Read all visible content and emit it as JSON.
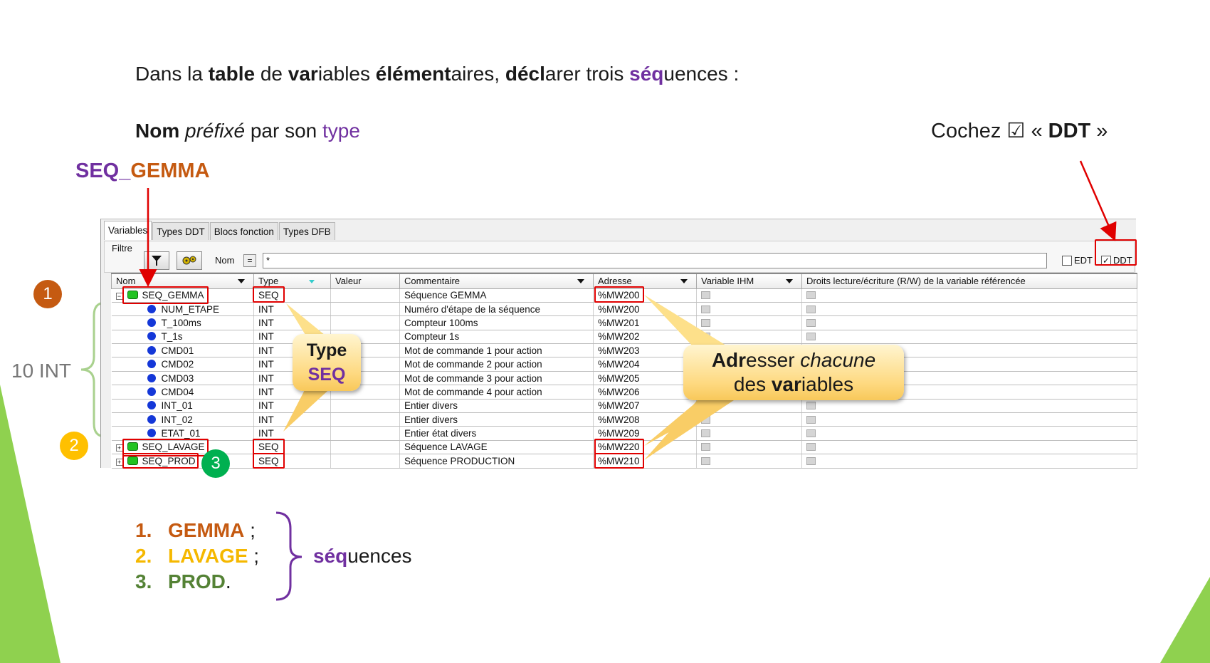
{
  "title": {
    "parts": [
      {
        "text": "Dans la ",
        "bold": false,
        "purple": false
      },
      {
        "text": "table",
        "bold": true,
        "purple": false
      },
      {
        "text": " de ",
        "bold": false,
        "purple": false
      },
      {
        "text": "var",
        "bold": true,
        "purple": false
      },
      {
        "text": "iables ",
        "bold": false,
        "purple": false
      },
      {
        "text": "élément",
        "bold": true,
        "purple": false
      },
      {
        "text": "aires, ",
        "bold": false,
        "purple": false
      },
      {
        "text": "décl",
        "bold": true,
        "purple": false
      },
      {
        "text": "arer trois ",
        "bold": false,
        "purple": false
      },
      {
        "text": "séq",
        "bold": true,
        "purple": true
      },
      {
        "text": "uences :",
        "bold": false,
        "purple": false
      }
    ]
  },
  "subtitle": {
    "nom": "Nom",
    "prefixe": "préfixé",
    "par_son": " par son ",
    "type": "type"
  },
  "cochez": {
    "before": "Cochez ☑ « ",
    "ddt": "DDT",
    "after": " »"
  },
  "seq_gemma_label": {
    "prefix": "SEQ_",
    "suffix": "GEMMA"
  },
  "ten_int_label": "10 INT",
  "badges": [
    "1",
    "2",
    "3"
  ],
  "window": {
    "tabs": [
      "Variables",
      "Types DDT",
      "Blocs fonction",
      "Types DFB"
    ],
    "filter_label": "Filtre",
    "nom_label": "Nom",
    "eq_label": "=",
    "filter_value": "*",
    "edt_label": "EDT",
    "ddt_label": "DDT",
    "columns": [
      "Nom",
      "Type",
      "Valeur",
      "Commentaire",
      "Adresse",
      "Variable IHM",
      "Droits lecture/écriture (R/W) de la variable référencée"
    ],
    "rows": [
      {
        "name": "SEQ_GEMMA",
        "type": "SEQ",
        "comment": "Séquence GEMMA",
        "address": "%MW200",
        "kind": "struct",
        "expand": "−"
      },
      {
        "name": "NUM_ETAPE",
        "type": "INT",
        "comment": "Numéro d'étape de la séquence",
        "address": "%MW200",
        "kind": "int"
      },
      {
        "name": "T_100ms",
        "type": "INT",
        "comment": "Compteur 100ms",
        "address": "%MW201",
        "kind": "int"
      },
      {
        "name": "T_1s",
        "type": "INT",
        "comment": "Compteur 1s",
        "address": "%MW202",
        "kind": "int"
      },
      {
        "name": "CMD01",
        "type": "INT",
        "comment": "Mot de commande 1 pour action",
        "address": "%MW203",
        "kind": "int"
      },
      {
        "name": "CMD02",
        "type": "INT",
        "comment": "Mot de commande 2 pour action",
        "address": "%MW204",
        "kind": "int"
      },
      {
        "name": "CMD03",
        "type": "INT",
        "comment": "Mot de commande 3 pour action",
        "address": "%MW205",
        "kind": "int"
      },
      {
        "name": "CMD04",
        "type": "INT",
        "comment": "Mot de commande 4 pour action",
        "address": "%MW206",
        "kind": "int"
      },
      {
        "name": "INT_01",
        "type": "INT",
        "comment": "Entier divers",
        "address": "%MW207",
        "kind": "int"
      },
      {
        "name": "INT_02",
        "type": "INT",
        "comment": "Entier divers",
        "address": "%MW208",
        "kind": "int"
      },
      {
        "name": "ETAT_01",
        "type": "INT",
        "comment": "Entier état divers",
        "address": "%MW209",
        "kind": "int"
      },
      {
        "name": "SEQ_LAVAGE",
        "type": "SEQ",
        "comment": "Séquence LAVAGE",
        "address": "%MW220",
        "kind": "struct",
        "expand": "+"
      },
      {
        "name": "SEQ_PROD",
        "type": "SEQ",
        "comment": "Séquence PRODUCTION",
        "address": "%MW210",
        "kind": "struct",
        "expand": "+"
      }
    ]
  },
  "type_callout": {
    "line1": "Type",
    "line2": "SEQ"
  },
  "addr_callout": {
    "a": "Adr",
    "b": "esser ",
    "c": "chacune",
    "d": "des ",
    "e": "var",
    "f": "iables"
  },
  "list": [
    {
      "num": "1.",
      "label": "GEMMA",
      "sep": " ;"
    },
    {
      "num": "2.",
      "label": "LAVAGE",
      "sep": " ;"
    },
    {
      "num": "3.",
      "label": "PROD",
      "sep": "."
    }
  ],
  "sequences_word": {
    "bold": "séq",
    "rest": "uences"
  },
  "colors": {
    "purple": "#7030a0",
    "orange": "#c55a11",
    "yellow": "#f5b800",
    "green": "#548235",
    "red": "#e00000",
    "accent_green": "#92d050"
  }
}
